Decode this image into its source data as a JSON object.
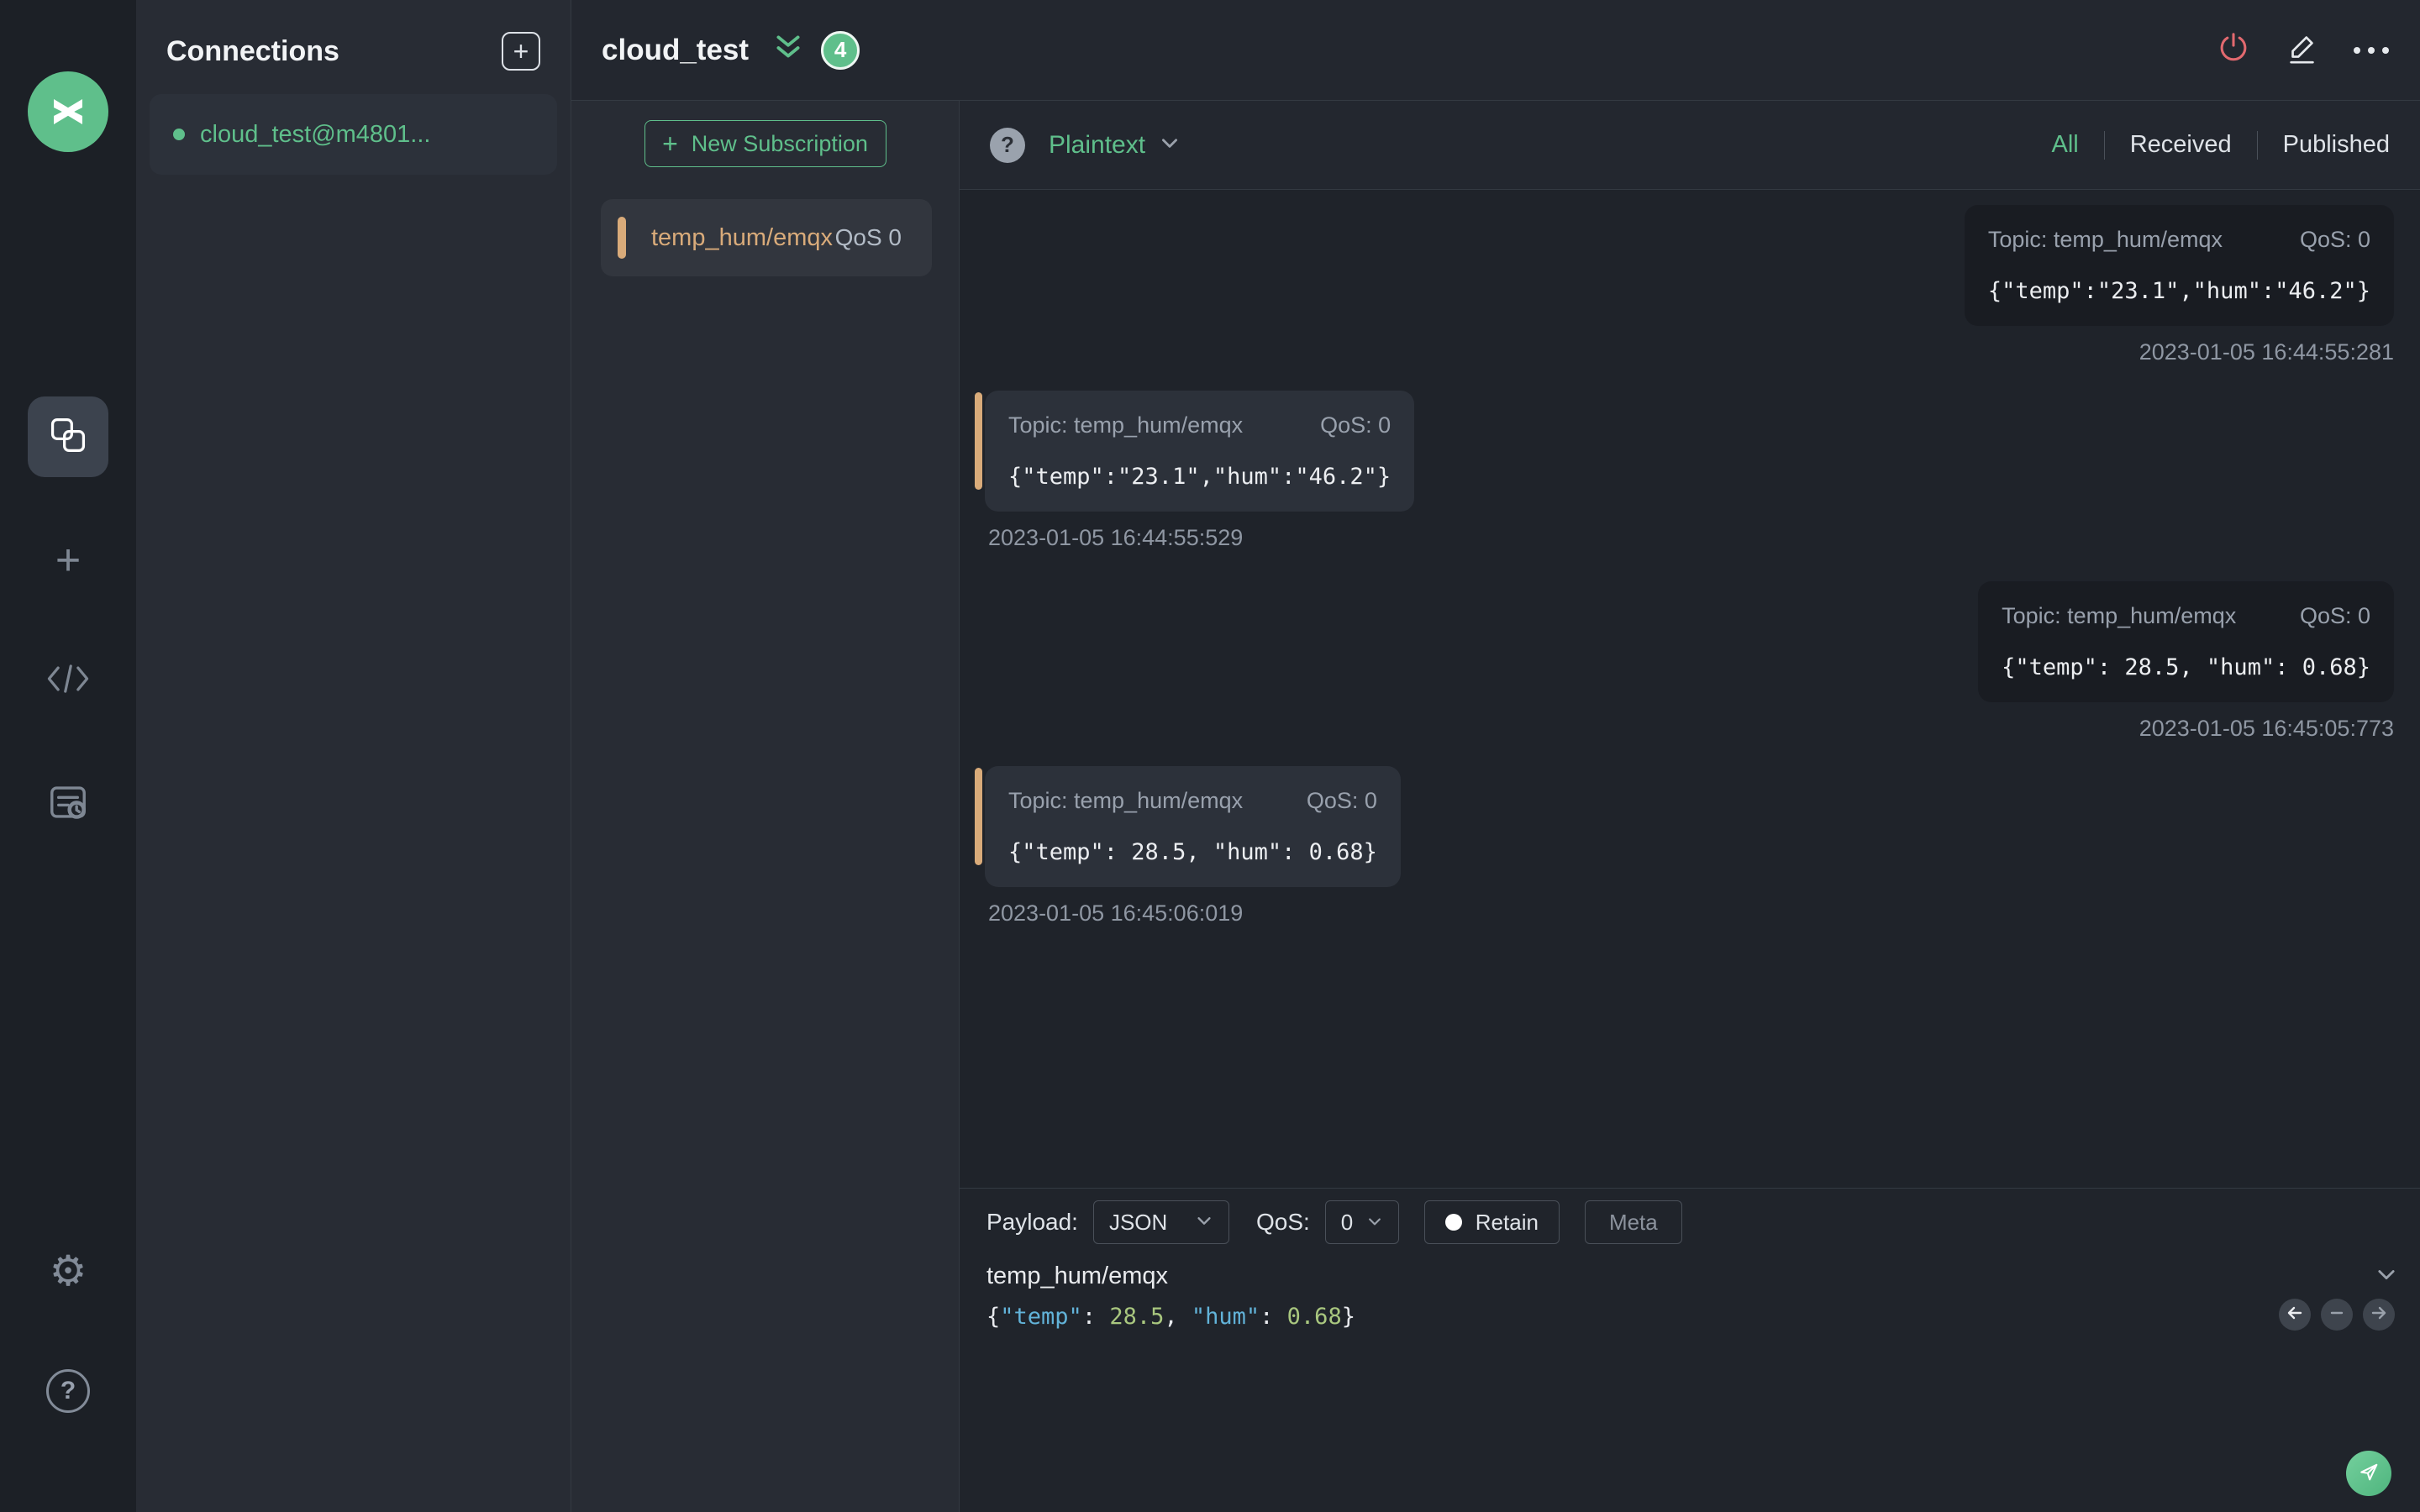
{
  "sidebar": {
    "plus_glyph": "+",
    "settings_glyph": "⚙",
    "help_glyph": "?"
  },
  "connections_panel": {
    "title": "Connections",
    "add_glyph": "+",
    "items": [
      {
        "label": "cloud_test@m4801...",
        "status": "connected"
      }
    ]
  },
  "header": {
    "title": "cloud_test",
    "message_count": "4"
  },
  "subscriptions_panel": {
    "new_button_glyph": "+",
    "new_button_label": "New Subscription",
    "items": [
      {
        "topic": "temp_hum/emqx",
        "qos": "QoS 0"
      }
    ]
  },
  "filter_bar": {
    "help_glyph": "?",
    "payload_format": "Plaintext",
    "active_tab": "All",
    "tabs": [
      {
        "label": "All"
      },
      {
        "label": "Received"
      },
      {
        "label": "Published"
      }
    ]
  },
  "messages": [
    {
      "direction": "published",
      "topic": "Topic: temp_hum/emqx",
      "qos": "QoS: 0",
      "payload": "{\"temp\":\"23.1\",\"hum\":\"46.2\"}",
      "timestamp": "2023-01-05 16:44:55:281"
    },
    {
      "direction": "received",
      "topic": "Topic: temp_hum/emqx",
      "qos": "QoS: 0",
      "payload": "{\"temp\":\"23.1\",\"hum\":\"46.2\"}",
      "timestamp": "2023-01-05 16:44:55:529"
    },
    {
      "direction": "published",
      "topic": "Topic: temp_hum/emqx",
      "qos": "QoS: 0",
      "payload": "{\"temp\": 28.5, \"hum\": 0.68}",
      "timestamp": "2023-01-05 16:45:05:773"
    },
    {
      "direction": "received",
      "topic": "Topic: temp_hum/emqx",
      "qos": "QoS: 0",
      "payload": "{\"temp\": 28.5, \"hum\": 0.68}",
      "timestamp": "2023-01-05 16:45:06:019"
    }
  ],
  "publish_panel": {
    "payload_label": "Payload:",
    "format_value": "JSON",
    "qos_label": "QoS:",
    "qos_value": "0",
    "retain_label": "Retain",
    "meta_label": "Meta",
    "topic_value": "temp_hum/emqx",
    "editor": {
      "p_open": "{",
      "key1": "\"temp\"",
      "c1": ": ",
      "v1": "28.5",
      "comma": ", ",
      "key2": "\"hum\"",
      "c2": ": ",
      "v2": "0.68",
      "p_close": "}"
    }
  },
  "colors": {
    "accent_green": "#5fbf8b",
    "topic_accent_tan": "#d9ab7a",
    "danger_red": "#e2696f",
    "bg_sidebar": "#1c2026",
    "bg_panel": "#282c34",
    "bg_main": "#1f232a",
    "bubble_received": "#2c313a",
    "bubble_published": "#191c22"
  }
}
